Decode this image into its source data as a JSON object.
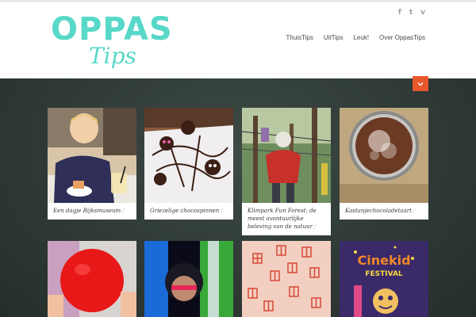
{
  "brand": {
    "name_main": "OPPAS",
    "name_sub": "Tips"
  },
  "social": {
    "facebook": "f",
    "twitter": "t",
    "vimeo": "v"
  },
  "nav": [
    {
      "label": "ThuisTips"
    },
    {
      "label": "UitTips"
    },
    {
      "label": "Leuk!"
    },
    {
      "label": "Over OppasTips"
    }
  ],
  "colors": {
    "accent": "#e8582c",
    "logo": "#58d8c8",
    "chalkboard": "#2f3a36"
  },
  "posts": [
    {
      "title": "Een dagje Rijksmuseum",
      "slash": "/"
    },
    {
      "title": "Griezelige chocospinnen",
      "slash": "/"
    },
    {
      "title": "Klimpark Fun Forest: de meest avontuurlijke beleving van de natuur",
      "slash": "/"
    },
    {
      "title": "Kastanjechocoladetaart",
      "slash": "/"
    }
  ],
  "posts_row2": [
    {
      "image": "red-balloon"
    },
    {
      "image": "neon-child"
    },
    {
      "image": "window-drawing"
    },
    {
      "image": "cinekid-festival",
      "text_top": "Cinekid",
      "text_bottom": "FESTIVAL"
    }
  ]
}
